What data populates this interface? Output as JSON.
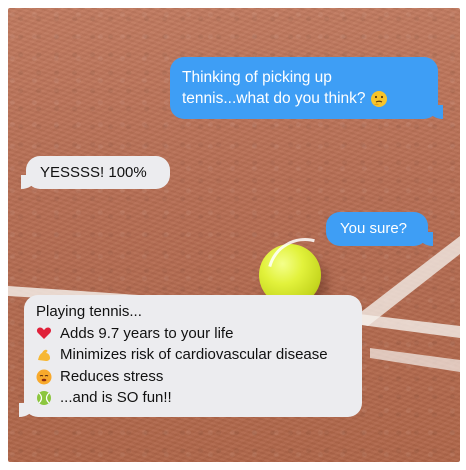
{
  "messages": {
    "outgoing_1": {
      "line1": "Thinking of picking up",
      "line2": "tennis...what do you think?"
    },
    "incoming_1": {
      "text": "YESSSS! 100%"
    },
    "outgoing_2": {
      "text": "You sure?"
    },
    "incoming_2": {
      "heading": "Playing tennis...",
      "items": [
        {
          "icon": "red-heart-icon",
          "text": "Adds 9.7 years to your life"
        },
        {
          "icon": "flexed-biceps-icon",
          "text": "Minimizes risk of cardiovascular disease"
        },
        {
          "icon": "relieved-face-icon",
          "text": "Reduces stress"
        },
        {
          "icon": "tennis-ball-icon",
          "text": "...and is SO fun!!"
        }
      ]
    }
  },
  "colors": {
    "outgoing_bubble": "#3e9ef5",
    "incoming_bubble": "#ececef",
    "court_clay": "#b86f55"
  }
}
